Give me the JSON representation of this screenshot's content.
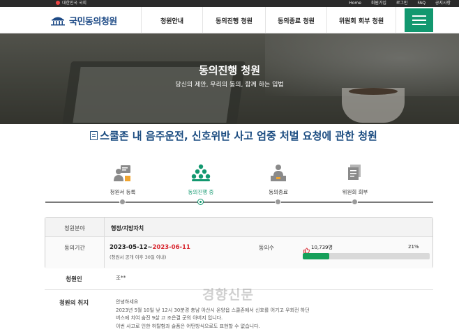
{
  "topbar": {
    "assembly": "대한민국 국회",
    "links": [
      "Home",
      "회원가입",
      "로그인",
      "FAQ",
      "공지사항"
    ]
  },
  "header": {
    "logo_text": "국민동의청원",
    "nav": [
      "청원안내",
      "동의진행 청원",
      "동의종료 청원",
      "위원회 회부 청원"
    ],
    "accent_color": "#12986f"
  },
  "hero": {
    "title": "동의진행 청원",
    "subtitle": "당신의 제안, 우리의 동의, 함께 하는 입법"
  },
  "petition": {
    "title": "스쿨존 내 음주운전, 신호위반 사고 엄중 처벌 요청에 관한 청원"
  },
  "steps": {
    "items": [
      {
        "label": "청원서 등록",
        "icon": "document-register-icon"
      },
      {
        "label": "동의진행 중",
        "icon": "people-group-icon"
      },
      {
        "label": "동의종료",
        "icon": "person-desk-icon"
      },
      {
        "label": "위원회 회부",
        "icon": "documents-stack-icon"
      }
    ],
    "active_index": 1
  },
  "info": {
    "field_label": "청원분야",
    "field_value": "행정/지방자치",
    "period_label": "동의기간",
    "period_start": "2023-05-12",
    "period_sep": "~",
    "period_end": "2023-06-11",
    "period_note": "(청원서 공개 이후 30일 이내)",
    "count_label": "동의수",
    "count_value": "10,739명",
    "percent_text": "21%",
    "progress": 0.21,
    "bar_color": "#16a05a"
  },
  "petitioner": {
    "label": "청원인",
    "name": "조**"
  },
  "purpose": {
    "label": "청원의 취지",
    "lines": [
      "안녕하세요",
      "2023년 5월 10일 낮 12시 30분경 충남 아산시 온양읍 스쿨존에서 신호를 어기고 우회전 하던",
      "버스에 치여 숨진 9살 고 조은결 군의 아버지 입니다.",
      "이번 사고로 인한 허탈함과 슬픔은 어떤방식으로도 표현할 수 없습니다."
    ]
  },
  "watermark": "경향신문"
}
